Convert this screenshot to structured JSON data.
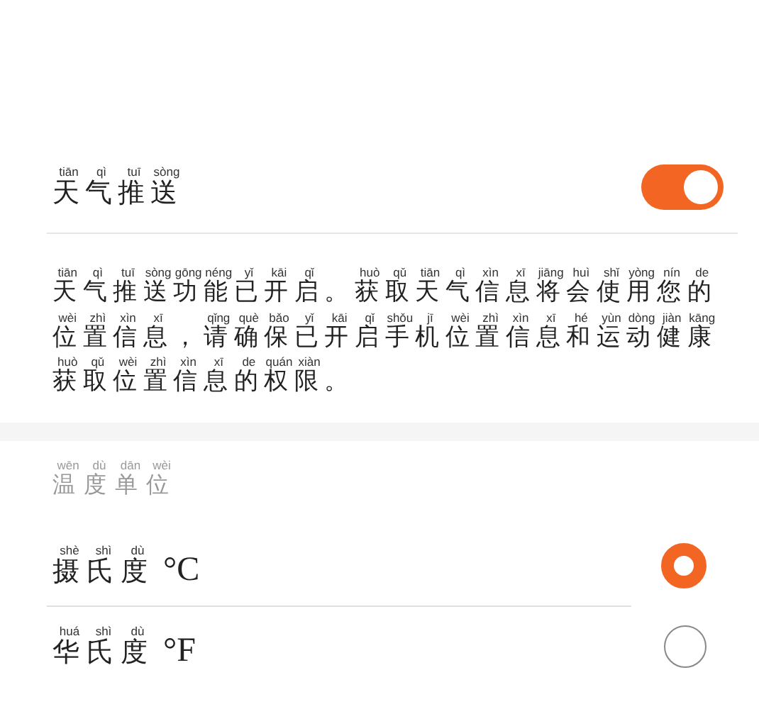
{
  "weather_push": {
    "label": "天气推送",
    "pinyin": [
      "tiān",
      "qì",
      "tuī",
      "sòng"
    ],
    "on": true
  },
  "description": {
    "lines": [
      {
        "text": "天气推送功能已开启。获取天气信息将会使用您的",
        "pinyin": [
          "tiān",
          "qì",
          "tuī",
          "sòng",
          "gōng",
          "néng",
          "yǐ",
          "kāi",
          "qǐ",
          "huò",
          "qǔ",
          "tiān",
          "qì",
          "xìn",
          "xī",
          "jiāng",
          "huì",
          "shǐ",
          "yòng",
          "nín",
          "de"
        ]
      },
      {
        "text": "位置信息，请确保已开启手机位置信息和运动健康",
        "pinyin": [
          "wèi",
          "zhì",
          "xìn",
          "xī",
          "qǐng",
          "què",
          "bǎo",
          "yǐ",
          "kāi",
          "qǐ",
          "shǒu",
          "jī",
          "wèi",
          "zhì",
          "xìn",
          "xī",
          "hé",
          "yùn",
          "dòng",
          "jiàn",
          "kāng"
        ]
      },
      {
        "text": "获取位置信息的权限。",
        "pinyin": [
          "huò",
          "qǔ",
          "wèi",
          "zhì",
          "xìn",
          "xī",
          "de",
          "quán",
          "xiàn"
        ]
      }
    ]
  },
  "unit_section": {
    "title": "温度单位",
    "pinyin": [
      "wēn",
      "dù",
      "dān",
      "wèi"
    ]
  },
  "units": [
    {
      "label": "摄氏度",
      "pinyin": [
        "shè",
        "shì",
        "dù"
      ],
      "symbol": "°C",
      "selected": true
    },
    {
      "label": "华氏度",
      "pinyin": [
        "huá",
        "shì",
        "dù"
      ],
      "symbol": "°F",
      "selected": false
    }
  ]
}
